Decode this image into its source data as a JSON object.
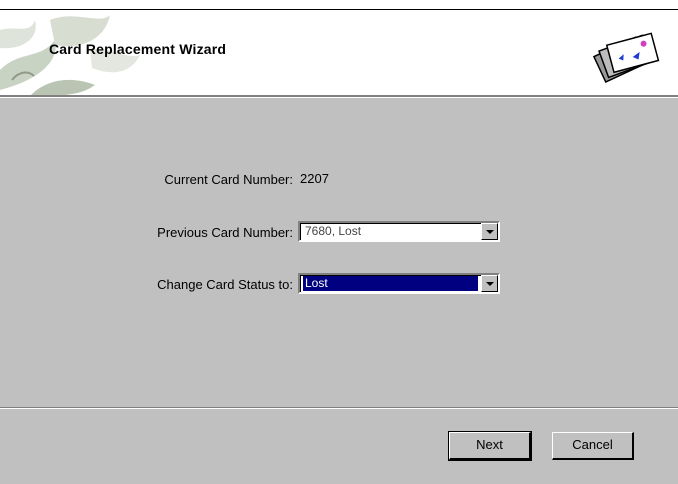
{
  "header": {
    "title": "Card Replacement Wizard",
    "art_icon": "ivy-leaves-art",
    "icon": "cards-icon"
  },
  "form": {
    "current_card": {
      "label": "Current Card Number:",
      "value": "2207"
    },
    "previous_card": {
      "label": "Previous Card Number:",
      "value": "7680, Lost"
    },
    "change_status": {
      "label": "Change Card Status to:",
      "value": "Lost"
    }
  },
  "buttons": {
    "next": "Next",
    "cancel": "Cancel"
  },
  "colors": {
    "selection": "#000080",
    "dialog_bg": "#c0c0c0"
  }
}
